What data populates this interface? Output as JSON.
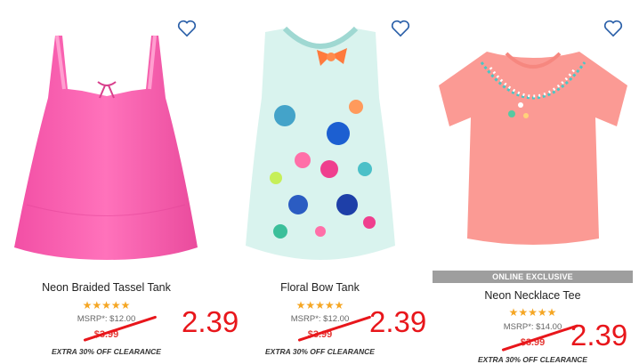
{
  "products": [
    {
      "name": "Neon Braided Tassel Tank",
      "rating_stars": "★★★★★",
      "msrp": "MSRP*: $12.00",
      "old_price": "$3.99",
      "promo": "EXTRA 30% OFF CLEARANCE",
      "new_price": "2.39",
      "badge": ""
    },
    {
      "name": "Floral Bow Tank",
      "rating_stars": "★★★★★",
      "msrp": "MSRP*: $12.00",
      "old_price": "$3.99",
      "promo": "EXTRA 30% OFF CLEARANCE",
      "new_price": "2.39",
      "badge": ""
    },
    {
      "name": "Neon Necklace Tee",
      "rating_stars": "★★★★★",
      "msrp": "MSRP*: $14.00",
      "old_price": "$3.99",
      "promo": "EXTRA 30% OFF CLEARANCE",
      "new_price": "2.39",
      "badge": "ONLINE EXCLUSIVE"
    }
  ],
  "icons": {
    "favorite": "heart-outline-icon"
  },
  "colors": {
    "heart": "#2a5fa8",
    "star": "#f5a623",
    "sale_red": "#e8161b",
    "badge_bg": "#9e9e9e"
  }
}
